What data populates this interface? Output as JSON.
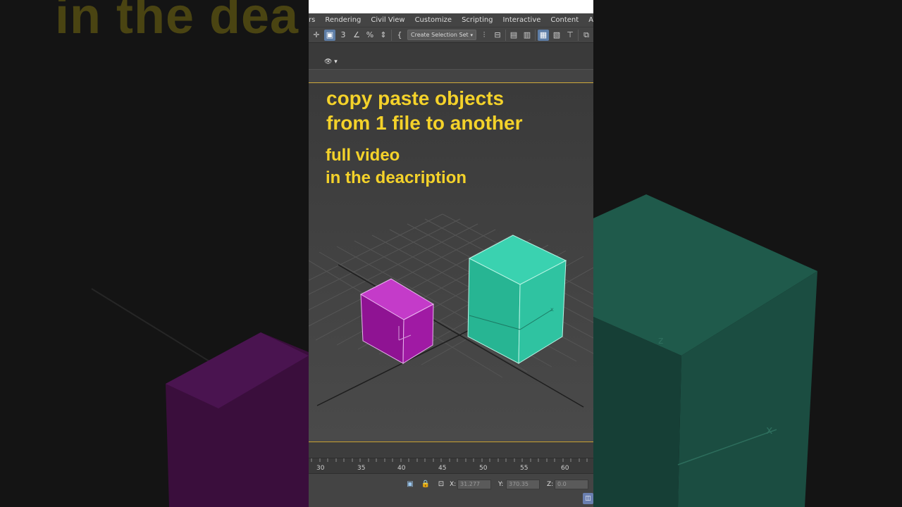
{
  "background": {
    "overlay_text": "in the dea"
  },
  "menubar": {
    "items": [
      "rs",
      "Rendering",
      "Civil View",
      "Customize",
      "Scripting",
      "Interactive",
      "Content",
      "Arnold"
    ]
  },
  "toolbar": {
    "selection_set_label": "Create Selection Set",
    "selection_set_arrow": "▾"
  },
  "subbar": {
    "eye_label": "👁 ▾"
  },
  "overlay": {
    "title_line1": "copy paste objects",
    "title_line2": "from 1 file to another",
    "sub_line1": "full video",
    "sub_line2": "in the deacription"
  },
  "ruler": {
    "ticks": [
      "30",
      "35",
      "40",
      "45",
      "50",
      "55",
      "60"
    ]
  },
  "statusbar": {
    "x_label": "X:",
    "x_value": "31.277",
    "y_label": "Y:",
    "y_value": "370.35",
    "z_label": "Z:",
    "z_value": "0.0"
  },
  "colors": {
    "overlay_text": "#f4d22a",
    "magenta_box": "#a21aa6",
    "teal_box": "#2fbf9e",
    "accent_line": "#c9a230"
  }
}
